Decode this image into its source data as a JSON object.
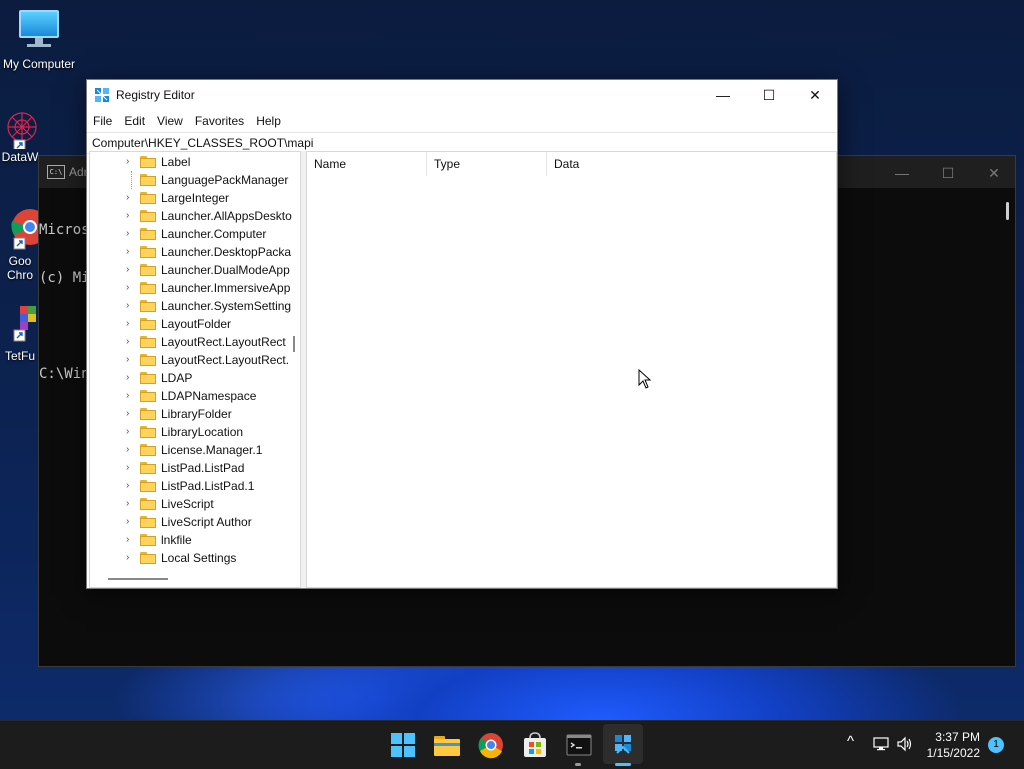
{
  "desktop": {
    "icons": [
      {
        "label": "My Computer"
      },
      {
        "label": "DataW"
      },
      {
        "label": "Goo"
      },
      {
        "label": "Chro"
      },
      {
        "label": "TetFu"
      }
    ]
  },
  "cmd_window": {
    "title": "Adr",
    "lines": [
      "Micros",
      "(c) Mi",
      "",
      "C:\\Win"
    ],
    "min": "—",
    "max": "☐",
    "close": "✕"
  },
  "registry": {
    "title": "Registry Editor",
    "min": "—",
    "max": "☐",
    "close": "✕",
    "menu": [
      "File",
      "Edit",
      "View",
      "Favorites",
      "Help"
    ],
    "address": "Computer\\HKEY_CLASSES_ROOT\\mapi",
    "tree": [
      {
        "label": "Label",
        "chev": "›"
      },
      {
        "label": "LanguagePackManager",
        "chev": ""
      },
      {
        "label": "LargeInteger",
        "chev": "›"
      },
      {
        "label": "Launcher.AllAppsDeskto",
        "chev": "›"
      },
      {
        "label": "Launcher.Computer",
        "chev": "›"
      },
      {
        "label": "Launcher.DesktopPacka",
        "chev": "›"
      },
      {
        "label": "Launcher.DualModeApp",
        "chev": "›"
      },
      {
        "label": "Launcher.ImmersiveApp",
        "chev": "›"
      },
      {
        "label": "Launcher.SystemSetting",
        "chev": "›"
      },
      {
        "label": "LayoutFolder",
        "chev": "›"
      },
      {
        "label": "LayoutRect.LayoutRect",
        "chev": "›"
      },
      {
        "label": "LayoutRect.LayoutRect.",
        "chev": "›"
      },
      {
        "label": "LDAP",
        "chev": "›"
      },
      {
        "label": "LDAPNamespace",
        "chev": "›"
      },
      {
        "label": "LibraryFolder",
        "chev": "›"
      },
      {
        "label": "LibraryLocation",
        "chev": "›"
      },
      {
        "label": "License.Manager.1",
        "chev": "›"
      },
      {
        "label": "ListPad.ListPad",
        "chev": "›"
      },
      {
        "label": "ListPad.ListPad.1",
        "chev": "›"
      },
      {
        "label": "LiveScript",
        "chev": "›"
      },
      {
        "label": "LiveScript Author",
        "chev": "›"
      },
      {
        "label": "lnkfile",
        "chev": "›"
      },
      {
        "label": "Local Settings",
        "chev": "›"
      }
    ],
    "columns": [
      "Name",
      "Type",
      "Data"
    ]
  },
  "taskbar": {
    "apps": [
      "start-icon",
      "file-explorer-icon",
      "chrome-icon",
      "store-icon",
      "terminal-icon",
      "regedit-icon"
    ],
    "tray_chevron": "^",
    "time": "3:37 PM",
    "date": "1/15/2022",
    "notification_count": "1"
  },
  "colors": {
    "accent": "#4cc2ff",
    "folder": "#ffd35c"
  }
}
